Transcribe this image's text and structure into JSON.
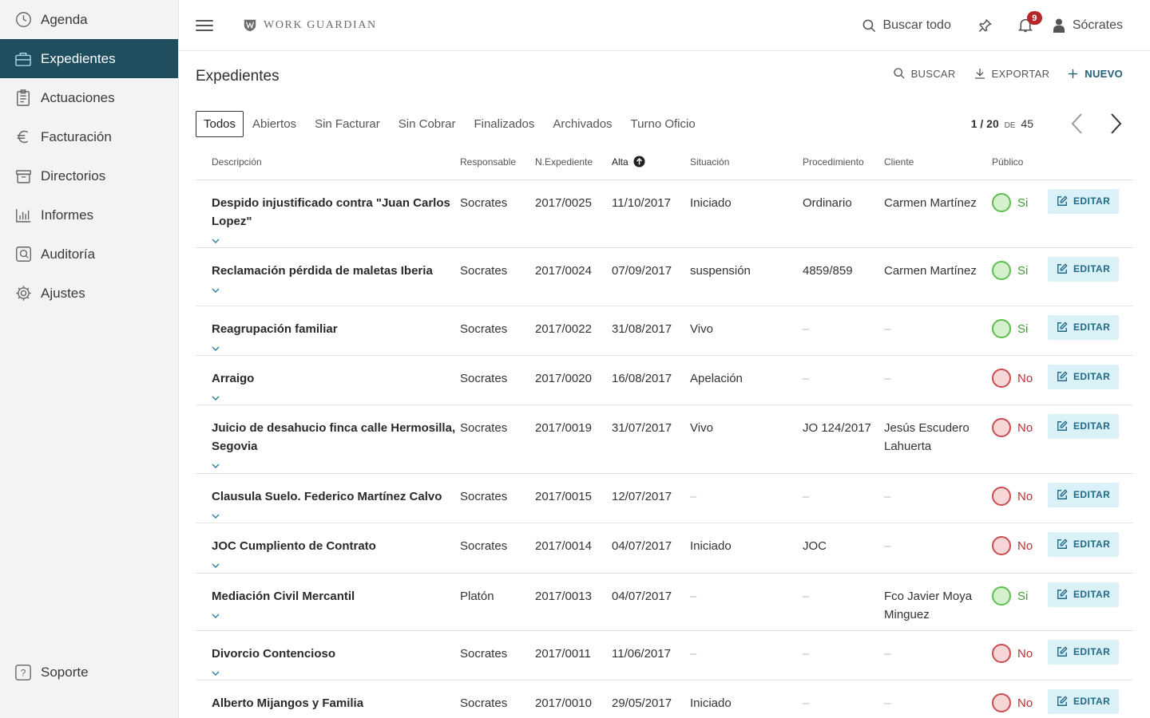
{
  "sidebar": {
    "items": [
      {
        "label": "Agenda",
        "icon": "clock-icon"
      },
      {
        "label": "Expedientes",
        "icon": "briefcase-icon"
      },
      {
        "label": "Actuaciones",
        "icon": "clipboard-icon"
      },
      {
        "label": "Facturación",
        "icon": "euro-icon"
      },
      {
        "label": "Directorios",
        "icon": "archive-icon"
      },
      {
        "label": "Informes",
        "icon": "bar-chart-icon"
      },
      {
        "label": "Auditoría",
        "icon": "audit-icon"
      },
      {
        "label": "Ajustes",
        "icon": "gear-icon"
      }
    ],
    "active": "Expedientes",
    "support": "Soporte"
  },
  "header": {
    "brand": "WORK GUARDIAN",
    "search_label": "Buscar todo",
    "notifications": "9",
    "user": "Sócrates"
  },
  "page": {
    "title": "Expedientes",
    "actions": {
      "search": "BUSCAR",
      "export": "EXPORTAR",
      "new": "NUEVO"
    }
  },
  "tabs": [
    "Todos",
    "Abiertos",
    "Sin Facturar",
    "Sin Cobrar",
    "Finalizados",
    "Archivados",
    "Turno Oficio"
  ],
  "active_tab": "Todos",
  "pagination": {
    "range": "1 / 20",
    "of": "DE",
    "total": "45"
  },
  "table": {
    "columns": [
      "Descripción",
      "Responsable",
      "N.Expediente",
      "Alta",
      "Situación",
      "Procedimiento",
      "Cliente",
      "Público"
    ],
    "sort_column": "Alta",
    "edit_label": "EDITAR",
    "rows": [
      {
        "desc": "Despido injustificado contra \"Juan Carlos Lopez\"",
        "resp": "Socrates",
        "exp": "2017/0025",
        "alta": "11/10/2017",
        "sit": "Iniciado",
        "proc": "Ordinario",
        "cli": "Carmen Martínez",
        "pub": "Si"
      },
      {
        "desc": "Reclamación pérdida de maletas Iberia",
        "resp": "Socrates",
        "exp": "2017/0024",
        "alta": "07/09/2017",
        "sit": "suspensión",
        "proc": "4859/859",
        "cli": "Carmen Martínez",
        "pub": "Si"
      },
      {
        "desc": "Reagrupación familiar",
        "resp": "Socrates",
        "exp": "2017/0022",
        "alta": "31/08/2017",
        "sit": "Vivo",
        "proc": "–",
        "cli": "–",
        "pub": "Si"
      },
      {
        "desc": "Arraigo",
        "resp": "Socrates",
        "exp": "2017/0020",
        "alta": "16/08/2017",
        "sit": "Apelación",
        "proc": "–",
        "cli": "–",
        "pub": "No"
      },
      {
        "desc": "Juicio de desahucio finca calle Hermosilla, Segovia",
        "resp": "Socrates",
        "exp": "2017/0019",
        "alta": "31/07/2017",
        "sit": "Vivo",
        "proc": "JO 124/2017",
        "cli": "Jesús Escudero Lahuerta",
        "pub": "No"
      },
      {
        "desc": "Clausula Suelo. Federico Martínez Calvo",
        "resp": "Socrates",
        "exp": "2017/0015",
        "alta": "12/07/2017",
        "sit": "–",
        "proc": "–",
        "cli": "–",
        "pub": "No"
      },
      {
        "desc": "JOC Cumpliento de Contrato",
        "resp": "Socrates",
        "exp": "2017/0014",
        "alta": "04/07/2017",
        "sit": "Iniciado",
        "proc": "JOC",
        "cli": "–",
        "pub": "No"
      },
      {
        "desc": "Mediación Civil Mercantil",
        "resp": "Platón",
        "exp": "2017/0013",
        "alta": "04/07/2017",
        "sit": "–",
        "proc": "–",
        "cli": "Fco Javier Moya Minguez",
        "pub": "Si"
      },
      {
        "desc": "Divorcio Contencioso",
        "resp": "Socrates",
        "exp": "2017/0011",
        "alta": "11/06/2017",
        "sit": "–",
        "proc": "–",
        "cli": "–",
        "pub": "No"
      },
      {
        "desc": "Alberto Mijangos y Familia",
        "resp": "Socrates",
        "exp": "2017/0010",
        "alta": "29/05/2017",
        "sit": "Iniciado",
        "proc": "–",
        "cli": "–",
        "pub": "No"
      }
    ]
  },
  "colors": {
    "sidebar_active": "#1f4e5f",
    "accent": "#1f5f78",
    "yes": "#3f9c33",
    "no": "#b83237",
    "badge": "#b5272a"
  }
}
